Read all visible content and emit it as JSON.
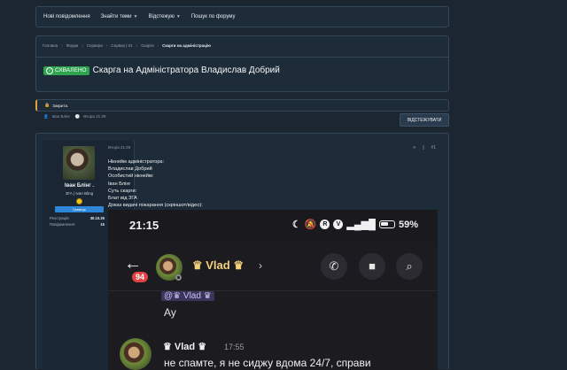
{
  "nav": {
    "items": [
      {
        "label": "Нові повідомлення",
        "caret": false
      },
      {
        "label": "Знайти теми",
        "caret": true
      },
      {
        "label": "Відстежую",
        "caret": true
      },
      {
        "label": "Пошук по форуму",
        "caret": false
      }
    ]
  },
  "breadcrumbs": [
    "Головна",
    "Форум",
    "Сервери",
    "Сервер | 01",
    "Скарги",
    "Скарги на адміністрацію"
  ],
  "thread": {
    "status_badge": "СХВАЛЕНО",
    "title": "Скарга на Адміністратора Владислав Добрий",
    "author": "Іван Блінг",
    "date": "Вчора 21:29"
  },
  "notice": {
    "closed": "Закрита."
  },
  "follow_button": "ВІДСТЕЖУВАТИ",
  "post": {
    "date": "Вчора 21:29",
    "number": "#1",
    "user": {
      "name": "Іван Блінг .",
      "title": "ЗГА | Ivan Bling",
      "banner": "Гравець",
      "stats": [
        {
          "label": "Реєстрація:",
          "value": "30.10.25"
        },
        {
          "label": "Повідомлення:",
          "value": "15"
        }
      ]
    },
    "lines": [
      "Нікнейм адміністратора:",
      "Владислав Добрий",
      "Особистий нікнейм:",
      "Іван Блінг",
      "Суть скарги:",
      "Блат від ЗГА",
      "Доказ видачі покарання (скріншот/відео):"
    ]
  },
  "screenshot": {
    "time": "21:15",
    "battery": "59%",
    "unread_count": "94",
    "chat_name": "♛ Vlad ♛",
    "quote_text": "@♛ Vlad ♛",
    "reply_text": "Ау",
    "message_author": "♛ Vlad ♛",
    "message_time": "17:55",
    "message_text": "не спамте, я не сиджу вдома 24/7, справи"
  }
}
